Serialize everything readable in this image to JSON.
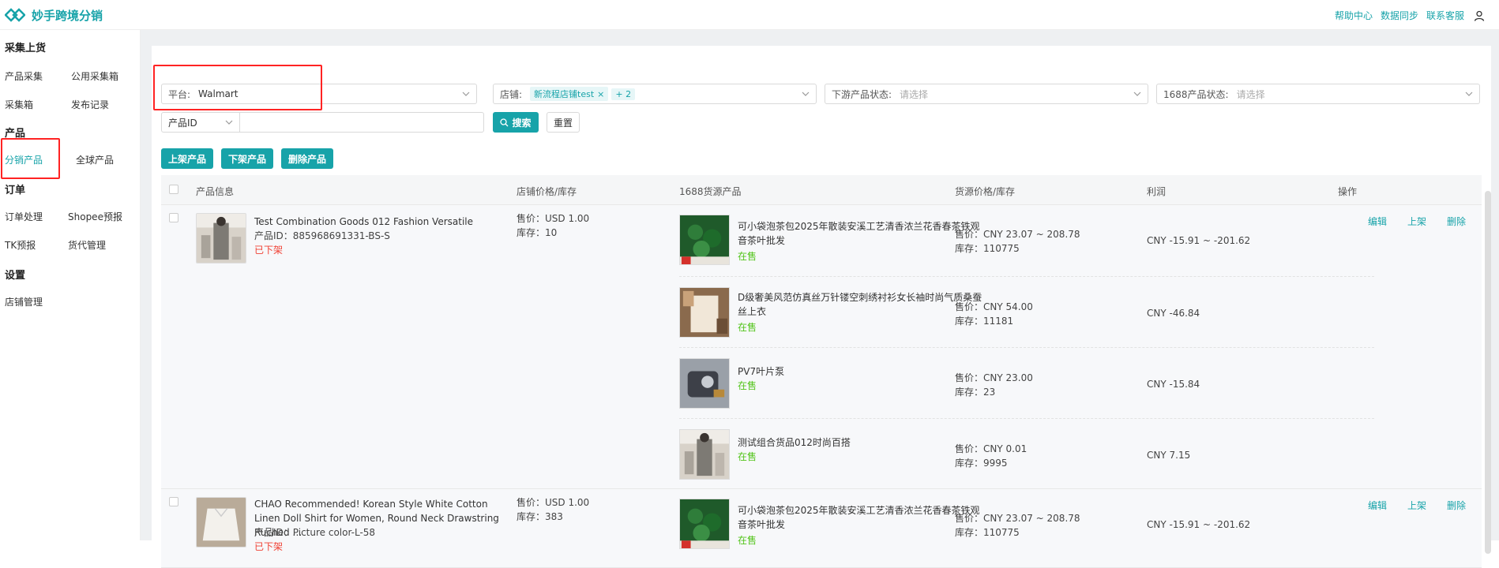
{
  "app": {
    "title": "妙手跨境分销"
  },
  "topbar": {
    "links": [
      "帮助中心",
      "数据同步",
      "联系客服"
    ]
  },
  "sidebar": {
    "sections": [
      {
        "title": "采集上货",
        "items": [
          "产品采集",
          "公用采集箱",
          "采集箱",
          "发布记录"
        ]
      },
      {
        "title": "产品",
        "items": [
          "分销产品",
          "全球产品"
        ]
      },
      {
        "title": "订单",
        "items": [
          "订单处理",
          "Shopee预报",
          "TK预报",
          "货代管理"
        ]
      },
      {
        "title": "设置",
        "items": [
          "店铺管理"
        ]
      }
    ],
    "active": "分销产品"
  },
  "filters": {
    "platform": {
      "label": "平台:",
      "value": "Walmart"
    },
    "store": {
      "label": "店铺:",
      "tag": "新流程店铺test",
      "more": "+ 2"
    },
    "downstream": {
      "label": "下游产品状态:",
      "placeholder": "请选择"
    },
    "status1688": {
      "label": "1688产品状态:",
      "placeholder": "请选择"
    },
    "id_type": "产品ID",
    "search_btn": "搜索",
    "reset_btn": "重置"
  },
  "actions": [
    "上架产品",
    "下架产品",
    "删除产品"
  ],
  "table": {
    "headers": [
      "产品信息",
      "店铺价格/库存",
      "1688货源产品",
      "货源价格/库存",
      "利润",
      "操作"
    ],
    "ops": [
      "编辑",
      "上架",
      "删除"
    ],
    "rows": [
      {
        "title": "Test Combination Goods 012 Fashion Versatile",
        "pid": "产品ID：885968691331-BS-S",
        "status": "已下架",
        "price": "售价：USD 1.00",
        "stock": "库存：10",
        "sources": [
          {
            "title": "可小袋泡茶包2025年散装安溪工艺清香浓兰花香春茶铁观音茶叶批发",
            "status": "在售",
            "price": "售价：CNY 23.07 ~ 208.78",
            "stock": "库存：110775",
            "profit": "CNY -15.91 ~ -201.62"
          },
          {
            "title": "D级奢美风范仿真丝万针镂空刺绣衬衫女长袖时尚气质桑蚕丝上衣",
            "status": "在售",
            "price": "售价：CNY 54.00",
            "stock": "库存：11181",
            "profit": "CNY -46.84"
          },
          {
            "title": "PV7叶片泵",
            "status": "在售",
            "price": "售价：CNY 23.00",
            "stock": "库存：23",
            "profit": "CNY -15.84"
          },
          {
            "title": "测试组合货品012时尚百搭",
            "status": "在售",
            "price": "售价：CNY 0.01",
            "stock": "库存：9995",
            "profit": "CNY 7.15"
          }
        ]
      },
      {
        "title": "CHAO Recommended! Korean Style White Cotton Linen Doll Shirt for Women, Round Neck Drawstring Ruched …",
        "pid": "产品ID：Picture color-L-58",
        "status": "已下架",
        "price": "售价：USD 1.00",
        "stock": "库存：383",
        "sources": [
          {
            "title": "可小袋泡茶包2025年散装安溪工艺清香浓兰花香春茶铁观音茶叶批发",
            "status": "在售",
            "price": "售价：CNY 23.07 ~ 208.78",
            "stock": "库存：110775",
            "profit": "CNY -15.91 ~ -201.62"
          }
        ]
      }
    ]
  },
  "colors": {
    "accent": "#17a3a9",
    "danger": "#f04134",
    "success": "#52c41a",
    "highlight": "#ff2323"
  }
}
